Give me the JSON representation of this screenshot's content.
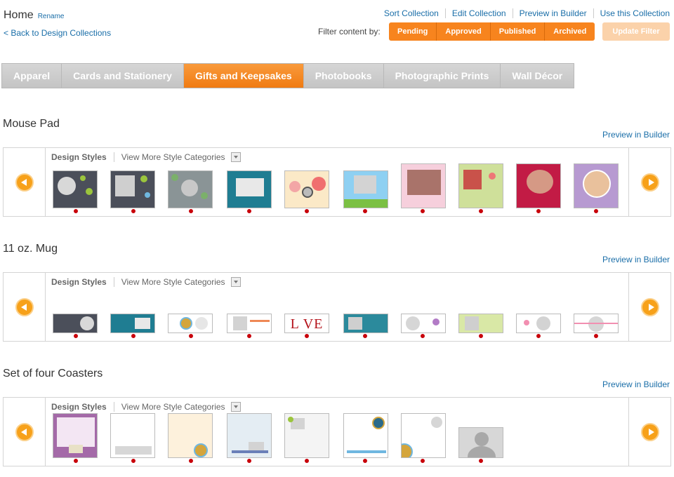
{
  "header": {
    "title": "Home",
    "rename": "Rename",
    "back": "< Back to Design Collections",
    "links": [
      "Sort Collection",
      "Edit Collection",
      "Preview in Builder",
      "Use this Collection"
    ],
    "filter_label": "Filter content by:",
    "filters": [
      "Pending",
      "Approved",
      "Published",
      "Archived"
    ],
    "update_filter": "Update Filter"
  },
  "tabs": [
    {
      "label": "Apparel",
      "active": false
    },
    {
      "label": "Cards and Stationery",
      "active": false
    },
    {
      "label": "Gifts and Keepsakes",
      "active": true
    },
    {
      "label": "Photobooks",
      "active": false
    },
    {
      "label": "Photographic Prints",
      "active": false
    },
    {
      "label": "Wall Décor",
      "active": false
    }
  ],
  "sections": [
    {
      "title": "Mouse Pad",
      "preview": "Preview in Builder",
      "styles_label": "Design Styles",
      "more_label": "View More Style Categories"
    },
    {
      "title": "11 oz. Mug",
      "preview": "Preview in Builder",
      "styles_label": "Design Styles",
      "more_label": "View More Style Categories",
      "love_text": "L VE"
    },
    {
      "title": "Set of four Coasters",
      "preview": "Preview in Builder",
      "styles_label": "Design Styles",
      "more_label": "View More Style Categories"
    }
  ],
  "colors": {
    "accent": "#f7841e",
    "link": "#1a6ea8",
    "status_dot": "#c8000a"
  }
}
